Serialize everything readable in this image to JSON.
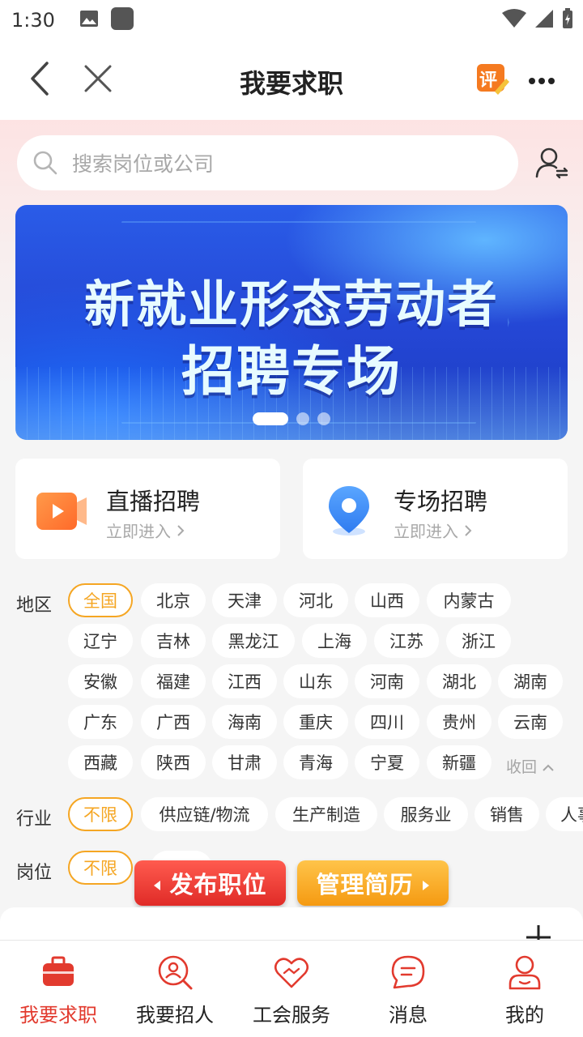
{
  "status_bar": {
    "time": "1:30"
  },
  "nav": {
    "title": "我要求职",
    "review_badge": "评"
  },
  "search": {
    "placeholder": "搜索岗位或公司"
  },
  "banner": {
    "line1": "新就业形态劳动者",
    "line2": "招聘专场",
    "slide_count": 3,
    "active_slide": 1
  },
  "entries": [
    {
      "title": "直播招聘",
      "subtitle": "立即进入"
    },
    {
      "title": "专场招聘",
      "subtitle": "立即进入"
    }
  ],
  "filters": {
    "region": {
      "label": "地区",
      "options": [
        "全国",
        "北京",
        "天津",
        "河北",
        "山西",
        "内蒙古",
        "辽宁",
        "吉林",
        "黑龙江",
        "上海",
        "江苏",
        "浙江",
        "安徽",
        "福建",
        "江西",
        "山东",
        "河南",
        "湖北",
        "湖南",
        "广东",
        "广西",
        "海南",
        "重庆",
        "四川",
        "贵州",
        "云南",
        "西藏",
        "陕西",
        "甘肃",
        "青海",
        "宁夏",
        "新疆"
      ],
      "selected": "全国",
      "collapse_label": "收回"
    },
    "industry": {
      "label": "行业",
      "options": [
        "不限",
        "供应链/物流",
        "生产制造",
        "服务业",
        "销售",
        "人事"
      ],
      "selected": "不限"
    },
    "position": {
      "label": "岗位",
      "options": [
        "不限"
      ],
      "selected": "不限"
    }
  },
  "actions": {
    "publish": "发布职位",
    "manage": "管理简历"
  },
  "tabs": [
    {
      "label": "我要求职",
      "icon": "briefcase-icon",
      "active": true
    },
    {
      "label": "我要招人",
      "icon": "recruit-search-icon",
      "active": false
    },
    {
      "label": "工会服务",
      "icon": "heart-handshake-icon",
      "active": false
    },
    {
      "label": "消息",
      "icon": "message-icon",
      "active": false
    },
    {
      "label": "我的",
      "icon": "profile-icon",
      "active": false
    }
  ],
  "colors": {
    "accent": "#f5a623",
    "active_tab": "#e23a2e",
    "publish_btn": "#e02b27",
    "manage_btn": "#f59a12"
  }
}
